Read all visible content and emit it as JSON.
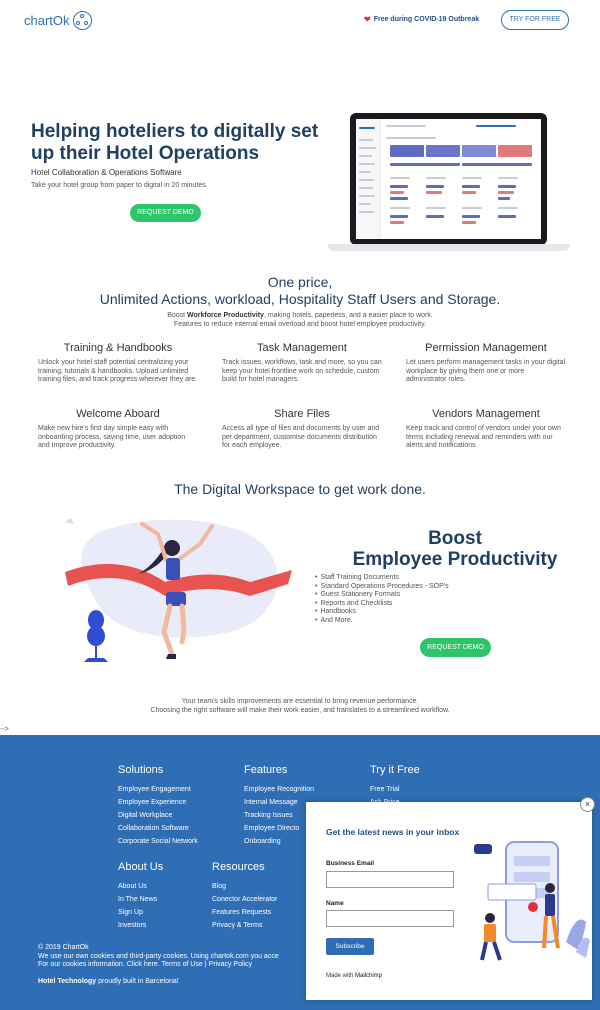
{
  "header": {
    "logo_text": "chartOk",
    "covid_text": "Free during COVID-19 Outbreak",
    "try_label": "TRY FOR FREE"
  },
  "hero": {
    "title": "Helping hoteliers to digitally set up their Hotel Operations",
    "subtitle": "Hotel Collaboration & Operations Software",
    "description": "Take your hotel group from paper to digital in 20 minutes.",
    "cta": "REQUEST DEMO"
  },
  "pricing": {
    "heading_line1": "One price,",
    "heading_line2": "Unlimited Actions, workload, Hospitality Staff Users and Storage.",
    "para_pre": "Boost ",
    "para_bold": "Workforce Productivity",
    "para_post": ", making hotels, paperless, and a easier place to work.",
    "para_line2": "Features to reduce internal email overload and boost hotel employee productivity."
  },
  "features": [
    {
      "title": "Training & Handbooks",
      "text": "Unlock your hotel staff potential centralizing your training, tutorials & handbooks. Upload unlimited training files, and track progress wherever they are."
    },
    {
      "title": "Task Management",
      "text": "Track issues, workflows, task and more, so you can keep your hotel frontline work on schedule, custom build for hotel managers."
    },
    {
      "title": "Permission Management",
      "text": "Let users perform management tasks in your digital workplace by giving them one or more administrator roles."
    },
    {
      "title": "Welcome Aboard",
      "text": "Make new hire's first day simple easy with onboarding process, saving time, user adoption and Improve productivity."
    },
    {
      "title": "Share Files",
      "text": "Access all type of files and documents by user and per department, customise documents distribution for each employee."
    },
    {
      "title": "Vendors Management",
      "text": "Keep track and control of vendors under your own terms including renewal and reminders with our alerts and notifications"
    }
  ],
  "workspace": {
    "title": "The Digital Workspace to get work done.",
    "boost_line1": "Boost",
    "boost_line2": "Employee Productivity",
    "list": [
      "Staff Training Documents",
      "Standard Operations Procedures - SOP's",
      "Guest Stationery Formats",
      "Reports and Checklists",
      "Handbooks",
      "And More."
    ],
    "cta": "REQUEST DEMO"
  },
  "skills": {
    "line1": "Your team's skills improvements are essential to bring revenue performance.",
    "line2": "Choosing the right software will make their work easier, and translates to a streamlined workflow."
  },
  "arrow_text": "-->",
  "footer": {
    "solutions": {
      "title": "Solutions",
      "links": [
        "Employee Engagement",
        "Employee Experience",
        "Digital Workplace",
        "Collaboration Software",
        "Corporate Social Network"
      ]
    },
    "features": {
      "title": "Features",
      "links": [
        "Employee Recognition",
        "Internal Message",
        "Tracking Issues",
        "Employee Directo",
        "Onboarding"
      ]
    },
    "try": {
      "title": "Try it Free",
      "links": [
        "Free Trial",
        "Ask Price"
      ]
    },
    "about": {
      "title": "About Us",
      "links": [
        "About Us",
        "In The News",
        "Sign Up",
        "Investors"
      ]
    },
    "resources": {
      "title": "Resources",
      "links": [
        "Blog",
        "Conector Accelerator",
        "Features Requests",
        "Privacy & Terms"
      ]
    },
    "copyright": "© 2019 ChartOk",
    "cookies_line1": "We use our own cookies and third-party cookies. Using chartok.com you acce",
    "cookies_line2": "For our cookies information. Click here. Terms of Use | Privacy Policy",
    "built_bold": "Hotel Technology",
    "built_rest": " proudly built in Barcelona!"
  },
  "popup": {
    "title": "Get the latest news in your inbox",
    "email_label": "Business Email",
    "name_label": "Name",
    "subscribe": "Subscribe",
    "made_with": "Made with ",
    "made_brand": "Mailchimp",
    "close": "×"
  },
  "colors": {
    "brand_blue": "#2f6eb5",
    "navy": "#1f4060",
    "green": "#2ec469",
    "ribbon": "#e8524f"
  }
}
